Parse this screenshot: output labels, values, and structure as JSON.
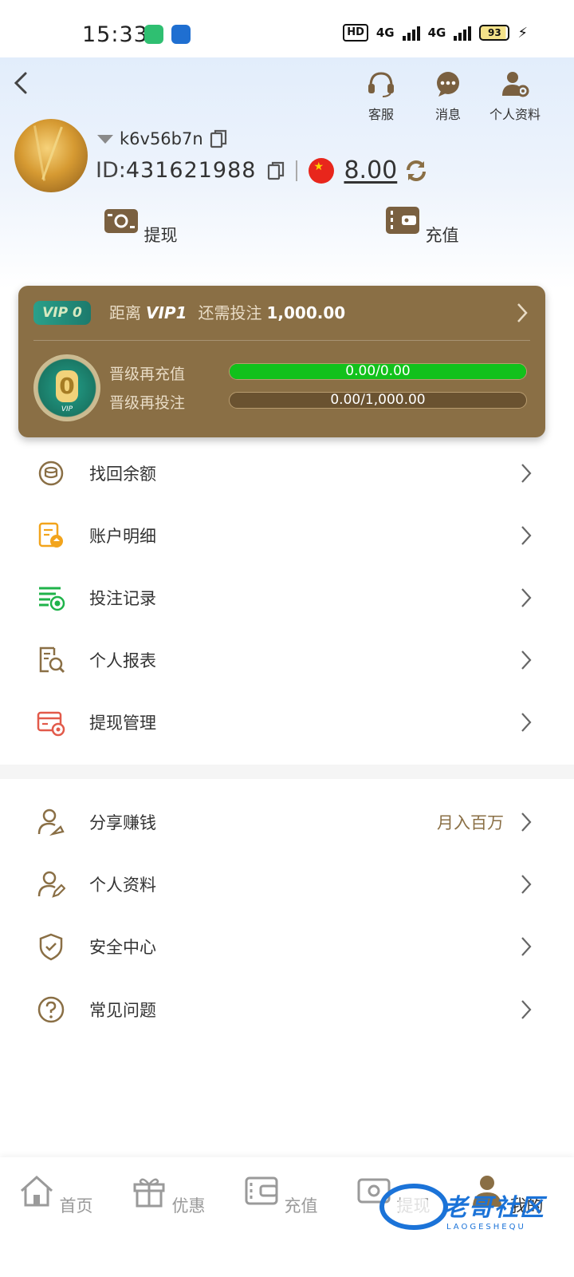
{
  "status_bar": {
    "time": "15:33",
    "hd": "HD",
    "net1": "4G",
    "net2": "4G",
    "battery": "93"
  },
  "header": {
    "actions": [
      {
        "label": "客服",
        "icon": "headset-icon"
      },
      {
        "label": "消息",
        "icon": "message-icon"
      },
      {
        "label": "个人资料",
        "icon": "user-settings-icon"
      }
    ]
  },
  "user": {
    "username": "k6v56b7n",
    "id_label": "ID:",
    "id_value": "431621988",
    "balance": "8.00",
    "currency_flag": "china-flag-icon"
  },
  "quick_actions": [
    {
      "label": "提现",
      "icon": "cash-icon"
    },
    {
      "label": "充值",
      "icon": "wallet-icon"
    }
  ],
  "vip": {
    "badge": "VIP 0",
    "prefix": "距离",
    "next_level": "VIP1",
    "middle": "还需投注",
    "amount": "1,000.00",
    "medal_number": "0",
    "medal_label": "VIP",
    "progress": [
      {
        "label": "晋级再充值",
        "text": "0.00/0.00",
        "fraction": 1.0
      },
      {
        "label": "晋级再投注",
        "text": "0.00/1,000.00",
        "fraction": 0.0
      }
    ]
  },
  "menu_group1": [
    {
      "label": "找回余额",
      "icon": "coin-retrieve-icon",
      "color": "#8a6f45"
    },
    {
      "label": "账户明细",
      "icon": "account-detail-icon",
      "color": "#f2a41c"
    },
    {
      "label": "投注记录",
      "icon": "bet-record-icon",
      "color": "#1fb34a"
    },
    {
      "label": "个人报表",
      "icon": "report-search-icon",
      "color": "#8a6f45"
    },
    {
      "label": "提现管理",
      "icon": "withdraw-manage-icon",
      "color": "#e25a4a"
    }
  ],
  "menu_group2": [
    {
      "label": "分享赚钱",
      "icon": "share-earn-icon",
      "extra": "月入百万"
    },
    {
      "label": "个人资料",
      "icon": "profile-edit-icon",
      "extra": ""
    },
    {
      "label": "安全中心",
      "icon": "shield-check-icon",
      "extra": ""
    },
    {
      "label": "常见问题",
      "icon": "question-icon",
      "extra": ""
    }
  ],
  "bottom_nav": [
    {
      "label": "首页",
      "icon": "home-icon"
    },
    {
      "label": "优惠",
      "icon": "gift-icon"
    },
    {
      "label": "充值",
      "icon": "wallet-icon"
    },
    {
      "label": "提现",
      "icon": "cash-icon"
    },
    {
      "label": "我的",
      "icon": "person-icon",
      "active": true
    }
  ],
  "watermark": {
    "text": "老哥社区",
    "sub": "LAOGESHEQU"
  },
  "colors": {
    "accent": "#8a6f45",
    "progress_green": "#12c11c",
    "vip_card": "#8a6f45"
  }
}
